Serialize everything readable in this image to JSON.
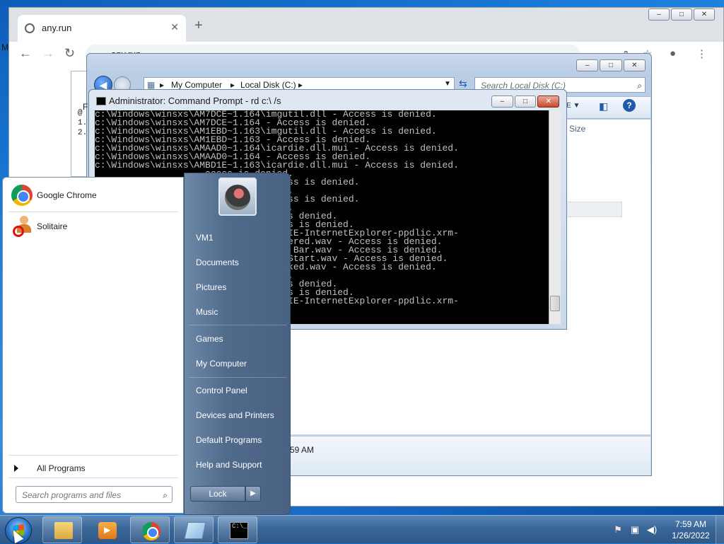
{
  "chrome": {
    "tab_title": "any.run",
    "url": "any.run",
    "side_letter": "M"
  },
  "sliver": {
    "lines": [
      "@",
      "1.",
      "2."
    ]
  },
  "explorer": {
    "address": [
      "My Computer",
      "Local Disk (C:)"
    ],
    "search_placeholder": "Search Local Disk (C:)",
    "col_size": "Size",
    "left_letter": "F",
    "details_time": "59 AM"
  },
  "cmd": {
    "title": "Administrator: Command Prompt - rd  c:\\ /s",
    "lines": [
      "c:\\Windows\\winsxs\\AM7DCE~1.164\\imgutil.dll - Access is denied.",
      "c:\\Windows\\winsxs\\AM7DCE~1.164 - Access is denied.",
      "c:\\Windows\\winsxs\\AM1EBD~1.163\\imgutil.dll - Access is denied.",
      "c:\\Windows\\winsxs\\AM1EBD~1.163 - Access is denied.",
      "c:\\Windows\\winsxs\\AMAAD0~1.164\\icardie.dll.mui - Access is denied.",
      "c:\\Windows\\winsxs\\AMAAD0~1.164 - Access is denied.",
      "c:\\Windows\\winsxs\\AMBD1E~1.163\\icardie.dll.mui - Access is denied.",
      "                    ccess is denied.",
      "                    rdie.dll - Access is denied.",
      "                    ccess is denied.",
      "                    rdie.dll - Access is denied.",
      "                    ccess is denied.",
      "                    .ico - Access is denied.",
      "                    att.exe - Access is denied.",
      "                    rosoft-Windows-IE-InternetExplorer-ppdlic.xrm-",
      "",
      "                    ows Feed Discovered.wav - Access is denied.",
      "                    ows Information Bar.wav - Access is denied.",
      "                    ows Navigation Start.wav - Access is denied.",
      "                    ows Pop-up Blocked.wav - Access is denied.",
      "                    ccess is denied.",
      "                    .ico - Access is denied.",
      "                    att.exe - Access is denied.",
      "                    rosoft-Windows-IE-InternetExplorer-ppdlic.xrm-"
    ]
  },
  "startmenu": {
    "programs": [
      {
        "label": "Google Chrome",
        "icon": "chrome-icon"
      },
      {
        "label": "Solitaire",
        "icon": "solitaire-icon"
      }
    ],
    "all_programs": "All Programs",
    "search_placeholder": "Search programs and files",
    "right_items": [
      "VM1",
      "Documents",
      "Pictures",
      "Music",
      "Games",
      "My Computer",
      "Control Panel",
      "Devices and Printers",
      "Default Programs",
      "Help and Support"
    ],
    "lock_label": "Lock",
    "lock_arrow": "▶"
  },
  "taskbar": {
    "time": "7:59 AM",
    "date": "1/26/2022",
    "items": [
      "explorer",
      "media-player",
      "chrome",
      "notepad",
      "command-prompt"
    ]
  }
}
